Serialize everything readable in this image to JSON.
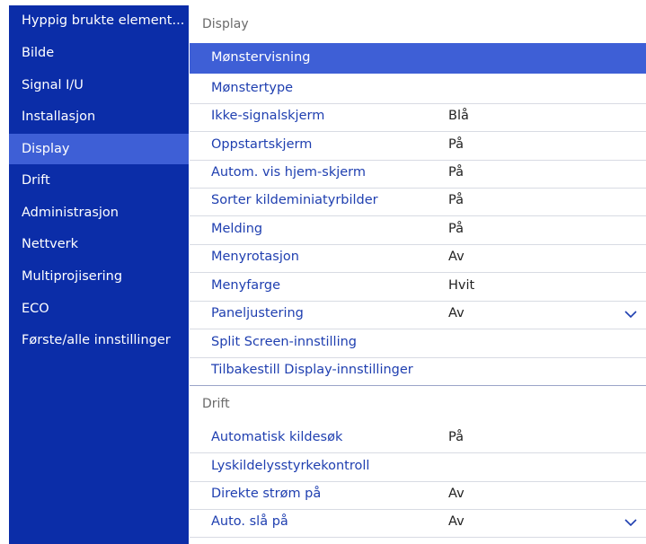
{
  "sidebar": {
    "items": [
      {
        "label": "Hyppig brukte element..."
      },
      {
        "label": "Bilde"
      },
      {
        "label": "Signal I/U"
      },
      {
        "label": "Installasjon"
      },
      {
        "label": "Display"
      },
      {
        "label": "Drift"
      },
      {
        "label": "Administrasjon"
      },
      {
        "label": "Nettverk"
      },
      {
        "label": "Multiprojisering"
      },
      {
        "label": "ECO"
      },
      {
        "label": "Første/alle innstillinger"
      }
    ],
    "active_index": 4
  },
  "main": {
    "display_section": {
      "title": "Display",
      "rows": [
        {
          "label": "Mønstervisning",
          "value": ""
        },
        {
          "label": "Mønstertype",
          "value": ""
        },
        {
          "label": "Ikke-signalskjerm",
          "value": "Blå"
        },
        {
          "label": "Oppstartskjerm",
          "value": "På"
        },
        {
          "label": "Autom. vis hjem-skjerm",
          "value": "På"
        },
        {
          "label": "Sorter kildeminiatyrbilder",
          "value": "På"
        },
        {
          "label": "Melding",
          "value": "På"
        },
        {
          "label": "Menyrotasjon",
          "value": "Av"
        },
        {
          "label": "Menyfarge",
          "value": "Hvit"
        },
        {
          "label": "Paneljustering",
          "value": "Av"
        },
        {
          "label": "Split Screen-innstilling",
          "value": ""
        },
        {
          "label": "Tilbakestill Display-innstillinger",
          "value": ""
        }
      ]
    },
    "drift_section": {
      "title": "Drift",
      "rows": [
        {
          "label": "Automatisk kildesøk",
          "value": "På"
        },
        {
          "label": "Lyskildelysstyrkekontroll",
          "value": ""
        },
        {
          "label": "Direkte strøm på",
          "value": "Av"
        },
        {
          "label": "Auto. slå på",
          "value": "Av"
        }
      ]
    }
  },
  "icons": {
    "dropdown": "chevron-down-icon"
  },
  "colors": {
    "sidebar_bg": "#0b2da8",
    "selected_bg": "#3e5fd6",
    "label_text": "#1f3fb0"
  }
}
